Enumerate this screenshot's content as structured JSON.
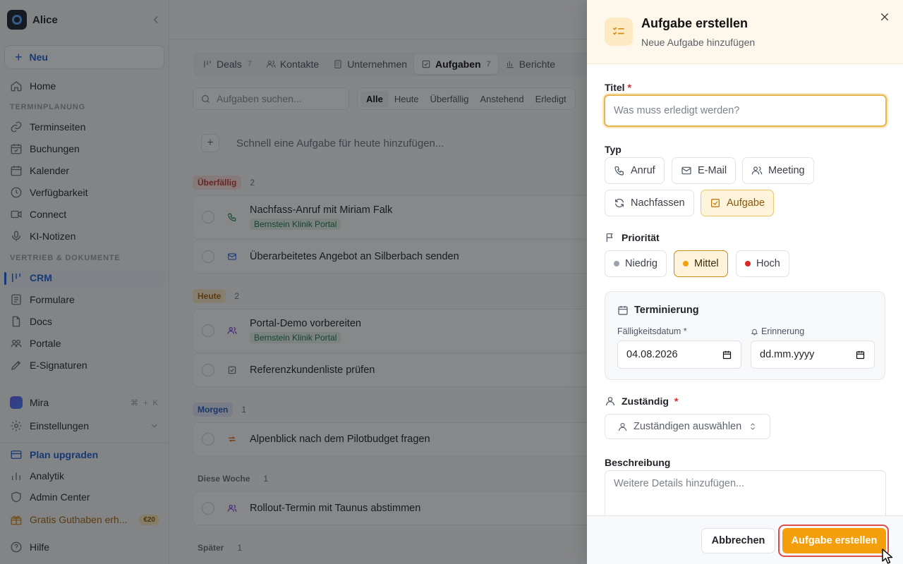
{
  "sidebar": {
    "workspace_name": "Alice",
    "new_label": "Neu",
    "home": "Home",
    "section_scheduling": "TERMINPLANUNG",
    "section_sales": "VERTRIEB & DOKUMENTE",
    "items": [
      {
        "label": "Terminseiten",
        "icon": "link-icon"
      },
      {
        "label": "Buchungen",
        "icon": "calendar-check-icon"
      },
      {
        "label": "Kalender",
        "icon": "calendar-icon"
      },
      {
        "label": "Verfügbarkeit",
        "icon": "clock-icon"
      },
      {
        "label": "Connect",
        "icon": "video-icon"
      },
      {
        "label": "KI-Notizen",
        "icon": "mic-icon"
      },
      {
        "label": "CRM",
        "icon": "crm-icon"
      },
      {
        "label": "Formulare",
        "icon": "form-icon"
      },
      {
        "label": "Docs",
        "icon": "doc-icon"
      },
      {
        "label": "Portale",
        "icon": "portal-icon"
      },
      {
        "label": "E-Signaturen",
        "icon": "pen-icon"
      }
    ],
    "mira": "Mira",
    "mira_shortcut": "⌘ + K",
    "settings": "Einstellungen",
    "upgrade": "Plan upgraden",
    "analytics": "Analytik",
    "admin": "Admin Center",
    "credit": "Gratis Guthaben erh...",
    "credit_badge": "€20",
    "help": "Hilfe"
  },
  "main": {
    "tabs": [
      {
        "label": "Deals",
        "count": "7"
      },
      {
        "label": "Kontakte",
        "count": ""
      },
      {
        "label": "Unternehmen",
        "count": ""
      },
      {
        "label": "Aufgaben",
        "count": "7"
      },
      {
        "label": "Berichte",
        "count": ""
      }
    ],
    "search_placeholder": "Aufgaben suchen...",
    "filters": [
      "Alle",
      "Heute",
      "Überfällig",
      "Anstehend",
      "Erledigt"
    ],
    "quick_add": "Schnell eine Aufgabe für heute hinzufügen...",
    "groups": [
      {
        "label": "Überfällig",
        "count": "2"
      },
      {
        "label": "Heute",
        "count": "2"
      },
      {
        "label": "Morgen",
        "count": "1"
      },
      {
        "label": "Diese Woche",
        "count": "1"
      },
      {
        "label": "Später",
        "count": "1"
      }
    ],
    "tasks": [
      {
        "title": "Nachfass-Anruf mit Miriam Falk",
        "company": "Bernstein Klinik Portal",
        "type": "phone-icon",
        "color": "#1a8a4a"
      },
      {
        "title": "Überarbeitetes Angebot an Silberbach senden",
        "company": "",
        "type": "mail-icon",
        "color": "#2563eb"
      },
      {
        "title": "Portal-Demo vorbereiten",
        "company": "Bernstein Klinik Portal",
        "type": "users-icon",
        "color": "#7c3aed"
      },
      {
        "title": "Referenzkundenliste prüfen",
        "company": "",
        "type": "checkbox-icon",
        "color": "#6b7280"
      },
      {
        "title": "Alpenblick nach dem Pilotbudget fragen",
        "company": "",
        "type": "repeat-icon",
        "color": "#ea580c"
      },
      {
        "title": "Rollout-Termin mit Taunus abstimmen",
        "company": "",
        "type": "users-icon",
        "color": "#7c3aed"
      }
    ]
  },
  "drawer": {
    "title": "Aufgabe erstellen",
    "subtitle": "Neue Aufgabe hinzufügen",
    "title_label": "Titel",
    "title_placeholder": "Was muss erledigt werden?",
    "type_label": "Typ",
    "types": [
      "Anruf",
      "E-Mail",
      "Meeting",
      "Nachfassen",
      "Aufgabe"
    ],
    "selected_type": "Aufgabe",
    "priority_label": "Priorität",
    "priorities": [
      {
        "label": "Niedrig",
        "color": "#9ca3af"
      },
      {
        "label": "Mittel",
        "color": "#f59e0b"
      },
      {
        "label": "Hoch",
        "color": "#dc2626"
      }
    ],
    "selected_priority": "Mittel",
    "scheduling_label": "Terminierung",
    "due_label": "Fälligkeitsdatum *",
    "due_value": "04.08.2026",
    "reminder_label": "Erinnerung",
    "reminder_value": "dd.mm.yyyy",
    "assignee_label": "Zuständig",
    "assignee_placeholder": "Zuständigen auswählen",
    "description_label": "Beschreibung",
    "description_placeholder": "Weitere Details hinzufügen...",
    "cancel": "Abbrechen",
    "submit": "Aufgabe erstellen",
    "required_mark": "*"
  }
}
